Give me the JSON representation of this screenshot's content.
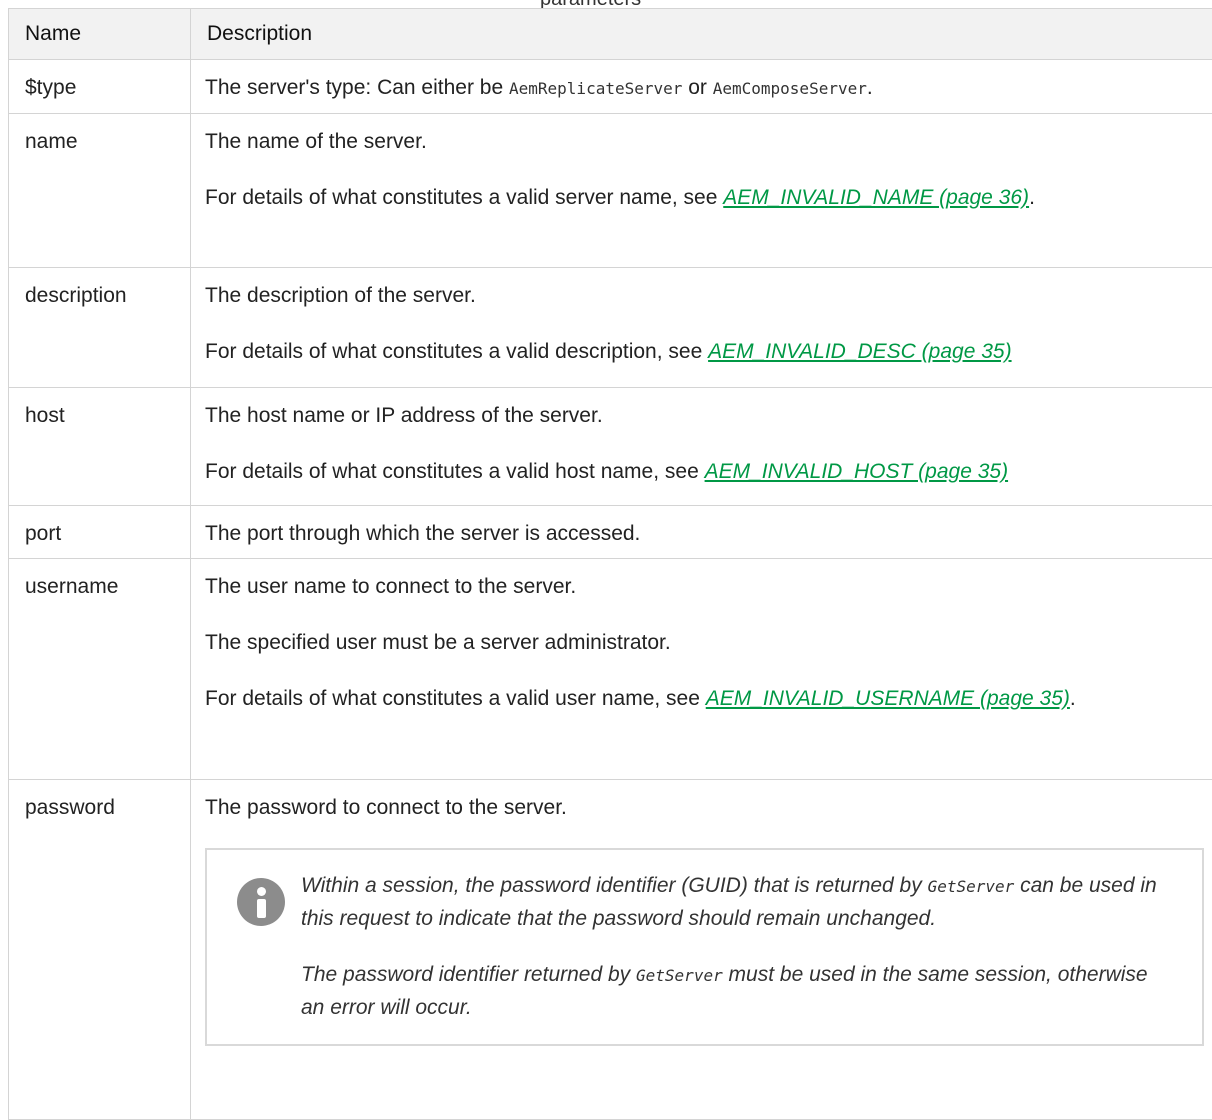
{
  "caption": "parameters",
  "table": {
    "headers": {
      "name": "Name",
      "description": "Description"
    },
    "rows": {
      "type": {
        "name": "$type",
        "text_before": "The server's type: Can either be ",
        "code1": "AemReplicateServer",
        "text_or": " or ",
        "code2": "AemComposeServer",
        "text_after": "."
      },
      "name": {
        "name": "name",
        "p1": "The name of the server.",
        "p2_text": "For details of what constitutes a valid server name, see ",
        "p2_link": "AEM_INVALID_NAME (page 36)",
        "p2_end": "."
      },
      "description": {
        "name": "description",
        "p1": "The description of the server.",
        "p2_text": "For details of what constitutes a valid description, see ",
        "p2_link": "AEM_INVALID_DESC (page 35)"
      },
      "host": {
        "name": "host",
        "p1": "The host name or IP address of the server.",
        "p2_text": "For details of what constitutes a valid host name, see ",
        "p2_link": "AEM_INVALID_HOST (page 35)"
      },
      "port": {
        "name": "port",
        "p1": "The port through which the server is accessed."
      },
      "username": {
        "name": "username",
        "p1": "The user name to connect to the server.",
        "p2": "The specified user must be a server administrator.",
        "p3_text": "For details of what constitutes a valid user name, see ",
        "p3_link": "AEM_INVALID_USERNAME (page 35)",
        "p3_end": "."
      },
      "password": {
        "name": "password",
        "p1": "The password to connect to the server.",
        "note": {
          "icon": "info-icon",
          "p1_before": "Within a session, the password identifier (GUID) that is returned by ",
          "p1_code": "GetServer",
          "p1_after": " can be used in this request to indicate that the password should remain unchanged.",
          "p2_before": "The password identifier returned by ",
          "p2_code": "GetServer",
          "p2_after": " must be used in the same session, otherwise an error will occur."
        }
      }
    }
  },
  "colors": {
    "link": "#009845",
    "header_bg": "#f2f2f2",
    "border": "#d4d4d4",
    "icon": "#8c8c8c"
  }
}
